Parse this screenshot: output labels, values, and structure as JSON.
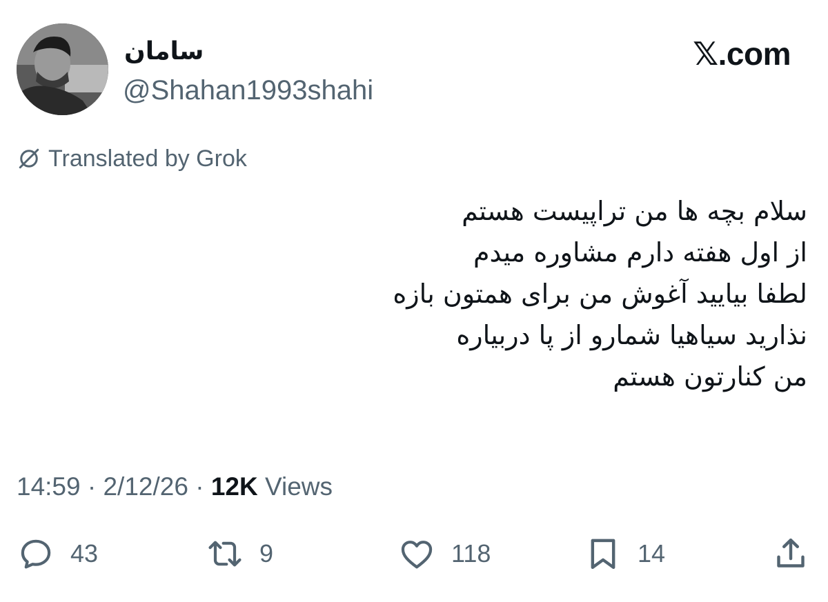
{
  "user": {
    "display_name": "سامان",
    "handle": "@Shahan1993shahi"
  },
  "brand": {
    "label": "𝕏.com"
  },
  "translation": {
    "label": "Translated by Grok",
    "icon": "globe-slash-icon"
  },
  "tweet": {
    "lines": [
      "سلام بچه ها من تراپیست هستم",
      "از اول هفته دارم مشاوره میدم",
      "لطفا بیایید آغوش من برای همتون بازه",
      "نذارید سیاهیا شمارو از پا دربیاره",
      "من کنارتون هستم"
    ]
  },
  "meta": {
    "time": "14:59",
    "separator": " · ",
    "date": "2/12/26",
    "views_count": "12K",
    "views_label": " Views"
  },
  "actions": {
    "reply_count": "43",
    "repost_count": "9",
    "like_count": "118",
    "bookmark_count": "14"
  },
  "colors": {
    "text_primary": "#0f1419",
    "text_secondary": "#536471",
    "background": "#ffffff"
  }
}
